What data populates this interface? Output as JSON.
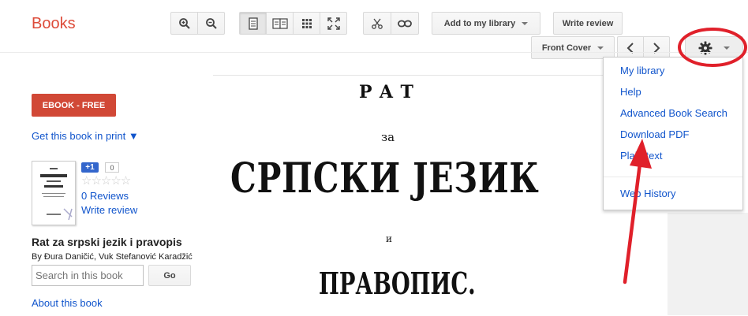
{
  "header": {
    "logo": "Books",
    "add_to_library": "Add to my library",
    "write_review": "Write review",
    "front_cover": "Front Cover"
  },
  "sidebar": {
    "ebook_button": "EBOOK - FREE",
    "get_in_print": "Get this book in print ▼",
    "plus_one": "+1",
    "plus_count": "0",
    "reviews": "0 Reviews",
    "write_review": "Write review",
    "title": "Rat za srpski jezik i pravopis",
    "authors": "By Đura Daničić, Vuk Stefanović Karadžić",
    "search_placeholder": "Search in this book",
    "go": "Go",
    "about": "About this book"
  },
  "page": {
    "line1": "РАТ",
    "line2": "за",
    "line3": "СРПСКИ ЈЕЗИК",
    "line4": "и",
    "line5": "ПРАВОПИС."
  },
  "menu": {
    "items": [
      "My library",
      "Help",
      "Advanced Book Search",
      "Download PDF",
      "Plain text",
      "Web History"
    ]
  },
  "colors": {
    "brand": "#dd4b39",
    "link": "#1155cc",
    "annotation": "#e0202a"
  }
}
